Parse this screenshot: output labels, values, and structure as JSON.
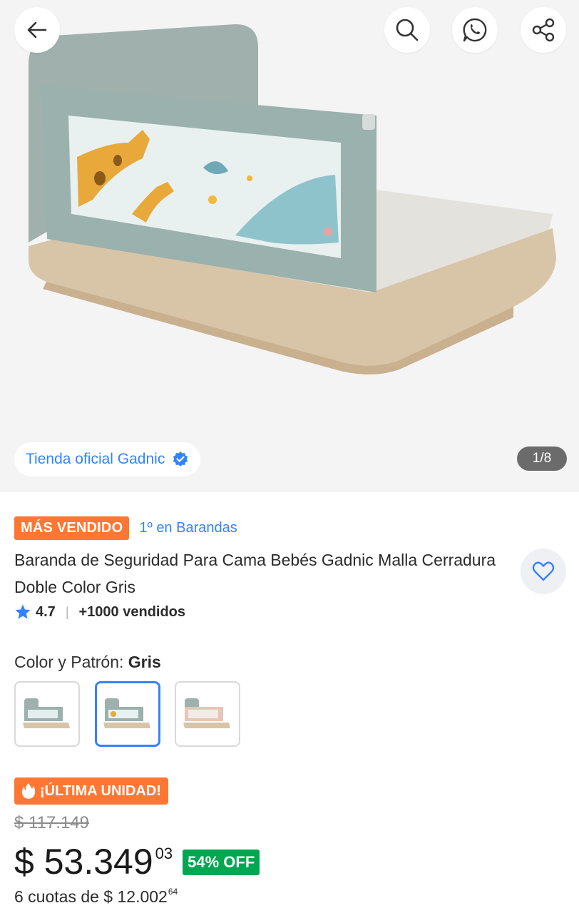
{
  "gallery": {
    "store_label": "Tienda oficial Gadnic",
    "counter": "1/8"
  },
  "icons": {
    "back": "arrow-left-icon",
    "search": "search-icon",
    "whatsapp": "whatsapp-icon",
    "share": "share-icon",
    "verified": "verified-badge-icon",
    "favorite": "heart-icon",
    "star": "star-icon",
    "flame": "flame-icon"
  },
  "product": {
    "badge": "MÁS VENDIDO",
    "category_rank": "1º en Barandas",
    "title": "Baranda de Seguridad Para Cama Bebés Gadnic Malla Cerradura Doble Color Gris",
    "rating": "4.7",
    "sold": "+1000 vendidos"
  },
  "variants": {
    "label": "Color y Patrón:",
    "selected": "Gris",
    "count": 3
  },
  "pricing": {
    "stock_badge": "¡ÚLTIMA UNIDAD!",
    "original_price": "$ 117.149",
    "price": "$ 53.349",
    "price_cents": "03",
    "discount": "54% OFF",
    "installments_text": "6 cuotas de $ 12.002",
    "installments_cents": "64"
  },
  "colors": {
    "accent": "#3483fa",
    "orange": "#ff7733",
    "green": "#00a650"
  }
}
